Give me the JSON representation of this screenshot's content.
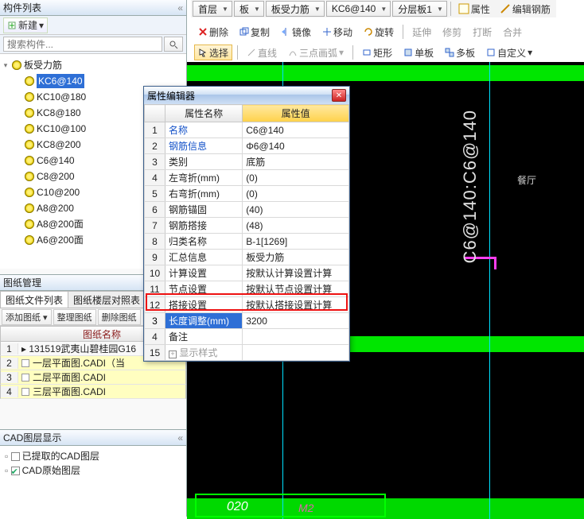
{
  "header": {
    "list_title": "构件列表",
    "new_btn": "新建",
    "search_placeholder": "搜索构件...",
    "dropdowns": [
      "首层",
      "板",
      "板受力筋",
      "KC6@140",
      "分层板1"
    ],
    "prop_btn": "属性",
    "edit_rebar_btn": "编辑钢筋"
  },
  "toolbar1": {
    "delete": "删除",
    "copy": "复制",
    "mirror": "镜像",
    "move": "移动",
    "rotate": "旋转",
    "extend": "延伸",
    "trim": "修剪",
    "break": "打断",
    "merge": "合并"
  },
  "toolbar2": {
    "select": "选择",
    "line": "直线",
    "arc": "三点画弧",
    "rect": "矩形",
    "single": "单板",
    "multi": "多板",
    "custom": "自定义"
  },
  "tree": {
    "root": "板受力筋",
    "items": [
      "KC6@140",
      "KC10@180",
      "KC8@180",
      "KC10@100",
      "KC8@200",
      "C6@140",
      "C8@200",
      "C10@200",
      "A8@200",
      "A8@200面",
      "A6@200面"
    ],
    "selected_index": 0
  },
  "drawings": {
    "pane_title": "图纸管理",
    "tabs": [
      "图纸文件列表",
      "图纸楼层对照表"
    ],
    "btns": [
      "添加图纸",
      "整理图纸",
      "删除图纸"
    ],
    "header": "图纸名称",
    "rows": [
      {
        "n": "1",
        "name": "131519武夷山碧桂园G16",
        "yel": false
      },
      {
        "n": "2",
        "name": "一层平面图.CADI（当",
        "yel": true
      },
      {
        "n": "3",
        "name": "二层平面图.CADI",
        "yel": true
      },
      {
        "n": "4",
        "name": "三层平面图.CADI",
        "yel": true
      }
    ]
  },
  "cad": {
    "title": "CAD图层显示",
    "items": [
      "已提取的CAD图层",
      "CAD原始图层"
    ],
    "checked": [
      false,
      true
    ]
  },
  "dialog": {
    "title": "属性编辑器",
    "col_name": "属性名称",
    "col_val": "属性值",
    "rows": [
      {
        "n": "1",
        "name": "名称",
        "val": "C6@140",
        "link": true
      },
      {
        "n": "2",
        "name": "钢筋信息",
        "val": "Φ6@140",
        "link": true
      },
      {
        "n": "3",
        "name": "类别",
        "val": "底筋"
      },
      {
        "n": "4",
        "name": "左弯折(mm)",
        "val": "(0)"
      },
      {
        "n": "5",
        "name": "右弯折(mm)",
        "val": "(0)"
      },
      {
        "n": "6",
        "name": "钢筋锚固",
        "val": "(40)"
      },
      {
        "n": "7",
        "name": "钢筋搭接",
        "val": "(48)"
      },
      {
        "n": "8",
        "name": "归类名称",
        "val": "B-1[1269]"
      },
      {
        "n": "9",
        "name": "汇总信息",
        "val": "板受力筋"
      },
      {
        "n": "10",
        "name": "计算设置",
        "val": "按默认计算设置计算"
      },
      {
        "n": "11",
        "name": "节点设置",
        "val": "按默认节点设置计算"
      },
      {
        "n": "12",
        "name": "搭接设置",
        "val": "按默认搭接设置计算"
      },
      {
        "n": "3",
        "name": "长度调整(mm)",
        "val": "3200",
        "hl": true
      },
      {
        "n": "4",
        "name": "备注",
        "val": ""
      },
      {
        "n": "15",
        "name": "显示样式",
        "val": "",
        "plus": true
      }
    ]
  },
  "canvas": {
    "room": "餐厅",
    "marker": "C6@140:C6@140",
    "bottom": "020",
    "bottom2": "M2"
  }
}
